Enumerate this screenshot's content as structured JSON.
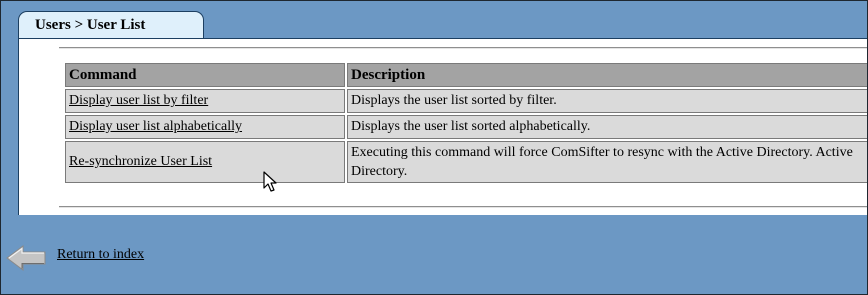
{
  "breadcrumb": {
    "label": "Users > User List"
  },
  "table": {
    "headers": [
      "Command",
      "Description"
    ],
    "rows": [
      {
        "command": "Display user list by filter",
        "description": "Displays the user list sorted by filter."
      },
      {
        "command": "Display user list alphabetically",
        "description": "Displays the user list sorted alphabetically."
      },
      {
        "command": "Re-synchronize User List",
        "description": "Executing this command will force ComSifter to resync with the Active Directory. Active Directory."
      }
    ]
  },
  "footer": {
    "return_label": "Return to index",
    "back_icon": "back-arrow-icon"
  },
  "colors": {
    "background": "#6c98c4",
    "tab": "#dff0fb",
    "header_cell": "#a3a3a3",
    "body_cell": "#dadada"
  }
}
